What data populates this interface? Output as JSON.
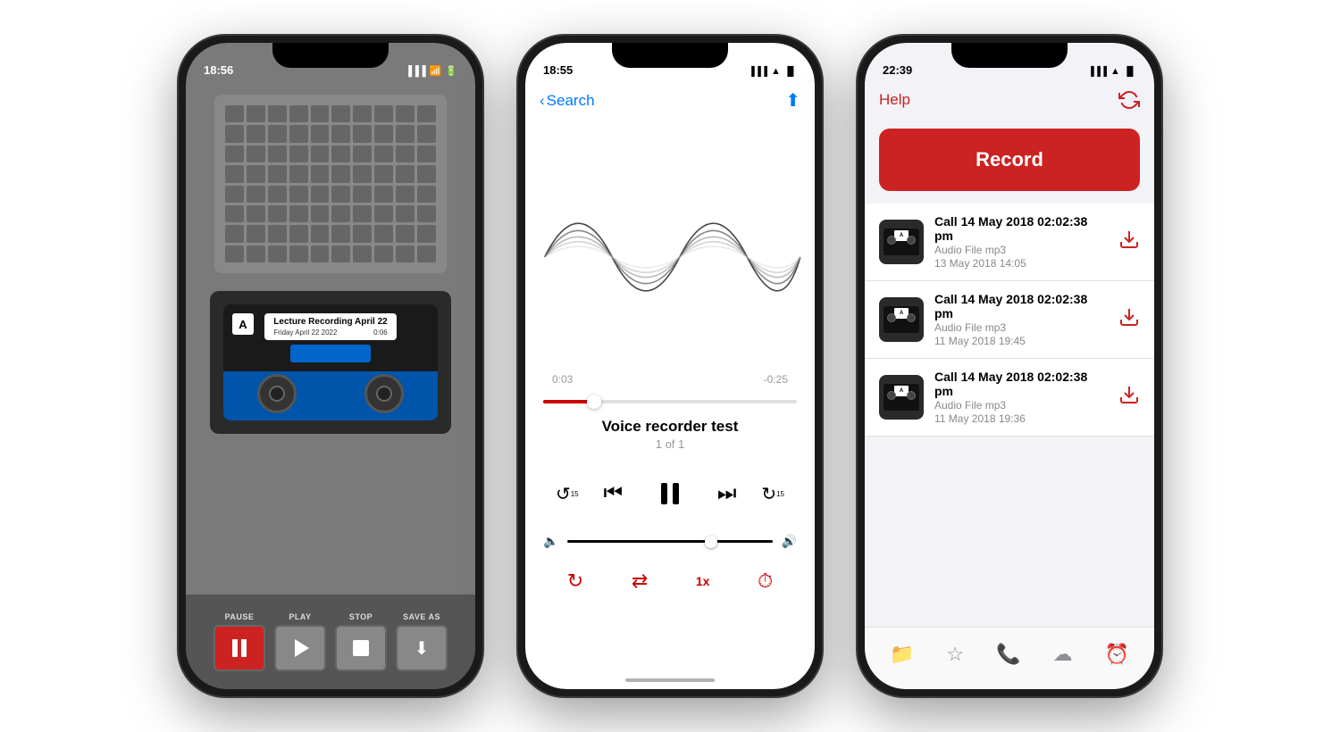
{
  "phone1": {
    "status_time": "18:56",
    "cassette_label_a": "A",
    "cassette_title": "Lecture Recording April 22",
    "cassette_date": "Friday April 22 2022",
    "cassette_time": "0:06",
    "buttons": {
      "pause": "PAUSE",
      "play": "PLAY",
      "stop": "STOP",
      "save_as": "SAVE AS"
    },
    "grille_cols": 10,
    "grille_rows": 8
  },
  "phone2": {
    "status_time": "18:55",
    "search_label": "Search",
    "track_title": "Voice recorder test",
    "track_sub": "1 of 1",
    "time_elapsed": "0:03",
    "time_remaining": "-0:25",
    "speed_label": "1x"
  },
  "phone3": {
    "status_time": "22:39",
    "help_label": "Help",
    "record_button_label": "Record",
    "recordings": [
      {
        "title": "Call 14 May 2018 02:02:38 pm",
        "type": "Audio File mp3",
        "date": "13 May 2018 14:05"
      },
      {
        "title": "Call 14 May 2018 02:02:38 pm",
        "type": "Audio File mp3",
        "date": "11 May 2018 19:45"
      },
      {
        "title": "Call 14 May 2018 02:02:38 pm",
        "type": "Audio File mp3",
        "date": "11 May 2018 19:36"
      }
    ],
    "tabs": [
      "files",
      "star",
      "phone",
      "cloud",
      "clock"
    ]
  },
  "colors": {
    "accent_red": "#cc2222",
    "accent_blue": "#007aff",
    "bg_gray": "#7a7a7a",
    "cassette_blue": "#0055aa"
  }
}
